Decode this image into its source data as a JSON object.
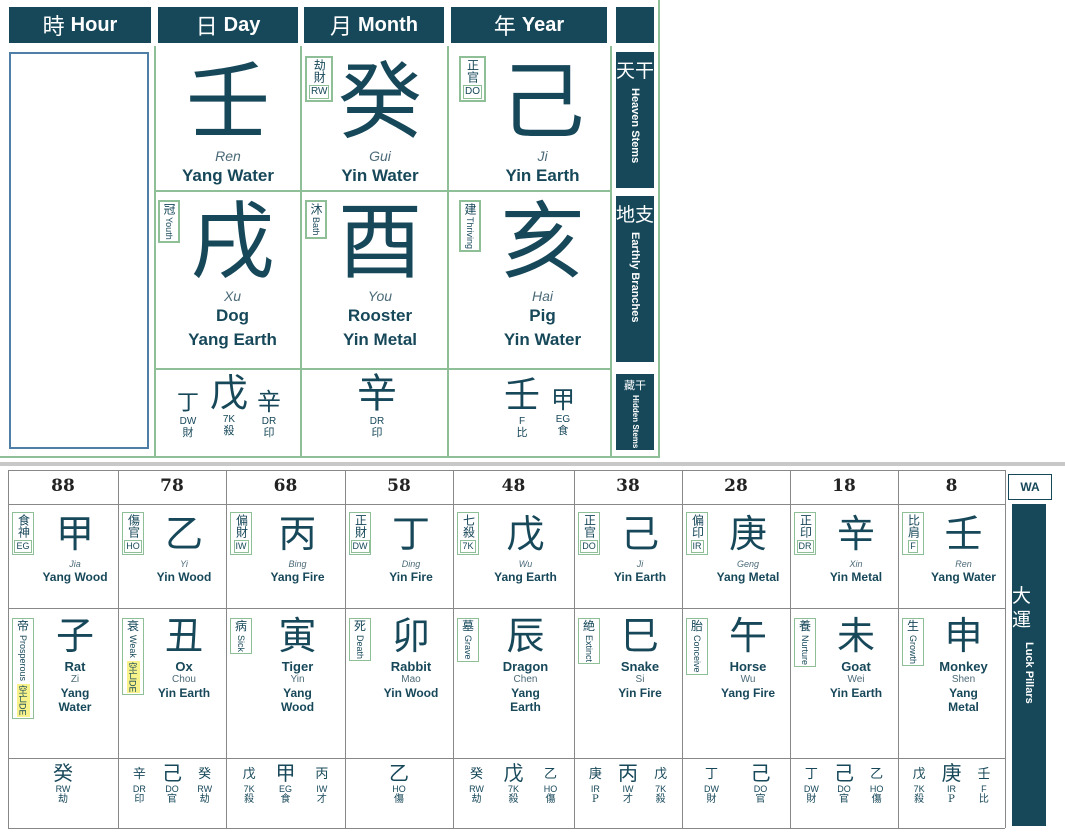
{
  "headers": {
    "hour": {
      "cj": "時",
      "en": "Hour"
    },
    "day": {
      "cj": "日",
      "en": "Day"
    },
    "month": {
      "cj": "月",
      "en": "Month"
    },
    "year": {
      "cj": "年",
      "en": "Year"
    }
  },
  "side": {
    "stems": {
      "cj": "天干",
      "en": "Heaven Stems"
    },
    "branches": {
      "cj": "地支",
      "en": "Earthly Branches"
    },
    "hidden": {
      "cj": "藏干",
      "en": "Hidden Stems"
    }
  },
  "stems": {
    "day": {
      "char": "壬",
      "pinyin": "Ren",
      "element": "Yang Water"
    },
    "month": {
      "char": "癸",
      "pinyin": "Gui",
      "element": "Yin Water",
      "tag_cj": "劫財",
      "tag_ab": "RW"
    },
    "year": {
      "char": "己",
      "pinyin": "Ji",
      "element": "Yin Earth",
      "tag_cj": "正官",
      "tag_ab": "DO"
    }
  },
  "branches": {
    "day": {
      "char": "戌",
      "pinyin": "Xu",
      "animal": "Dog",
      "element": "Yang Earth",
      "tag_cj": "冠",
      "tag_en": "Youth"
    },
    "month": {
      "char": "酉",
      "pinyin": "You",
      "animal": "Rooster",
      "element": "Yin Metal",
      "tag_cj": "沐",
      "tag_en": "Bath"
    },
    "year": {
      "char": "亥",
      "pinyin": "Hai",
      "animal": "Pig",
      "element": "Yin Water",
      "tag_cj": "建",
      "tag_en": "Thriving"
    }
  },
  "hidden": {
    "day": [
      {
        "char": "丁",
        "ab": "DW",
        "cj": "財"
      },
      {
        "char": "戊",
        "ab": "7K",
        "cj": "殺"
      },
      {
        "char": "辛",
        "ab": "DR",
        "cj": "印"
      }
    ],
    "month": [
      {
        "char": "辛",
        "ab": "DR",
        "cj": "印"
      }
    ],
    "year": [
      {
        "char": "壬",
        "ab": "F",
        "cj": "比"
      },
      {
        "char": "甲",
        "ab": "EG",
        "cj": "食"
      }
    ]
  },
  "luck": {
    "wa_label": "WA",
    "side_cj": "大運",
    "side_en": "Luck Pillars",
    "pillars": [
      {
        "age": "88",
        "stem": "甲",
        "stem_pin": "Jia",
        "stem_el": "Yang Wood",
        "stag_cj": "食神",
        "stag_ab": "EG",
        "branch": "子",
        "animal": "Rat",
        "bpin": "Zi",
        "bel1": "Yang",
        "bel2": "Water",
        "btag_cj": "帝",
        "btag_en": "Prosperous",
        "void": "空亡DE",
        "hid": [
          {
            "char": "癸",
            "ab": "RW",
            "cj": "劫"
          }
        ]
      },
      {
        "age": "78",
        "stem": "乙",
        "stem_pin": "Yi",
        "stem_el": "Yin Wood",
        "stag_cj": "傷官",
        "stag_ab": "HO",
        "branch": "丑",
        "animal": "Ox",
        "bpin": "Chou",
        "bel1": "Yin Earth",
        "bel2": "",
        "btag_cj": "衰",
        "btag_en": "Weak",
        "void": "空亡DE",
        "hid": [
          {
            "char": "辛",
            "ab": "DR",
            "cj": "印"
          },
          {
            "char": "己",
            "ab": "DO",
            "cj": "官"
          },
          {
            "char": "癸",
            "ab": "RW",
            "cj": "劫"
          }
        ]
      },
      {
        "age": "68",
        "stem": "丙",
        "stem_pin": "Bing",
        "stem_el": "Yang Fire",
        "stag_cj": "偏財",
        "stag_ab": "IW",
        "branch": "寅",
        "animal": "Tiger",
        "bpin": "Yin",
        "bel1": "Yang",
        "bel2": "Wood",
        "btag_cj": "病",
        "btag_en": "Sick",
        "void": "",
        "hid": [
          {
            "char": "戊",
            "ab": "7K",
            "cj": "殺"
          },
          {
            "char": "甲",
            "ab": "EG",
            "cj": "食"
          },
          {
            "char": "丙",
            "ab": "IW",
            "cj": "才"
          }
        ]
      },
      {
        "age": "58",
        "stem": "丁",
        "stem_pin": "Ding",
        "stem_el": "Yin Fire",
        "stag_cj": "正財",
        "stag_ab": "DW",
        "branch": "卯",
        "animal": "Rabbit",
        "bpin": "Mao",
        "bel1": "Yin Wood",
        "bel2": "",
        "btag_cj": "死",
        "btag_en": "Death",
        "void": "",
        "hid": [
          {
            "char": "乙",
            "ab": "HO",
            "cj": "傷"
          }
        ]
      },
      {
        "age": "48",
        "stem": "戊",
        "stem_pin": "Wu",
        "stem_el": "Yang Earth",
        "stag_cj": "七殺",
        "stag_ab": "7K",
        "branch": "辰",
        "animal": "Dragon",
        "bpin": "Chen",
        "bel1": "Yang",
        "bel2": "Earth",
        "btag_cj": "墓",
        "btag_en": "Grave",
        "void": "",
        "hid": [
          {
            "char": "癸",
            "ab": "RW",
            "cj": "劫"
          },
          {
            "char": "戊",
            "ab": "7K",
            "cj": "殺"
          },
          {
            "char": "乙",
            "ab": "HO",
            "cj": "傷"
          }
        ]
      },
      {
        "age": "38",
        "stem": "己",
        "stem_pin": "Ji",
        "stem_el": "Yin Earth",
        "stag_cj": "正官",
        "stag_ab": "DO",
        "branch": "巳",
        "animal": "Snake",
        "bpin": "Si",
        "bel1": "Yin Fire",
        "bel2": "",
        "btag_cj": "絶",
        "btag_en": "Extinct",
        "void": "",
        "hid": [
          {
            "char": "庚",
            "ab": "IR",
            "cj": "P"
          },
          {
            "char": "丙",
            "ab": "IW",
            "cj": "才"
          },
          {
            "char": "戊",
            "ab": "7K",
            "cj": "殺"
          }
        ]
      },
      {
        "age": "28",
        "stem": "庚",
        "stem_pin": "Geng",
        "stem_el": "Yang Metal",
        "stag_cj": "偏印",
        "stag_ab": "IR",
        "branch": "午",
        "animal": "Horse",
        "bpin": "Wu",
        "bel1": "Yang Fire",
        "bel2": "",
        "btag_cj": "胎",
        "btag_en": "Conceive",
        "void": "",
        "hid": [
          {
            "char": "丁",
            "ab": "DW",
            "cj": "財"
          },
          {
            "char": "己",
            "ab": "DO",
            "cj": "官"
          }
        ]
      },
      {
        "age": "18",
        "stem": "辛",
        "stem_pin": "Xin",
        "stem_el": "Yin Metal",
        "stag_cj": "正印",
        "stag_ab": "DR",
        "branch": "未",
        "animal": "Goat",
        "bpin": "Wei",
        "bel1": "Yin Earth",
        "bel2": "",
        "btag_cj": "養",
        "btag_en": "Nurture",
        "void": "",
        "hid": [
          {
            "char": "丁",
            "ab": "DW",
            "cj": "財"
          },
          {
            "char": "己",
            "ab": "DO",
            "cj": "官"
          },
          {
            "char": "乙",
            "ab": "HO",
            "cj": "傷"
          }
        ]
      },
      {
        "age": "8",
        "stem": "壬",
        "stem_pin": "Ren",
        "stem_el": "Yang Water",
        "stag_cj": "比肩",
        "stag_ab": "F",
        "branch": "申",
        "animal": "Monkey",
        "bpin": "Shen",
        "bel1": "Yang",
        "bel2": "Metal",
        "btag_cj": "生",
        "btag_en": "Growth",
        "void": "",
        "hid": [
          {
            "char": "戊",
            "ab": "7K",
            "cj": "殺"
          },
          {
            "char": "庚",
            "ab": "IR",
            "cj": "P"
          },
          {
            "char": "壬",
            "ab": "F",
            "cj": "比"
          }
        ]
      }
    ]
  },
  "colors": {
    "panel": "#16485a",
    "grid": "#8fbf96",
    "void": "#f7f28a"
  }
}
